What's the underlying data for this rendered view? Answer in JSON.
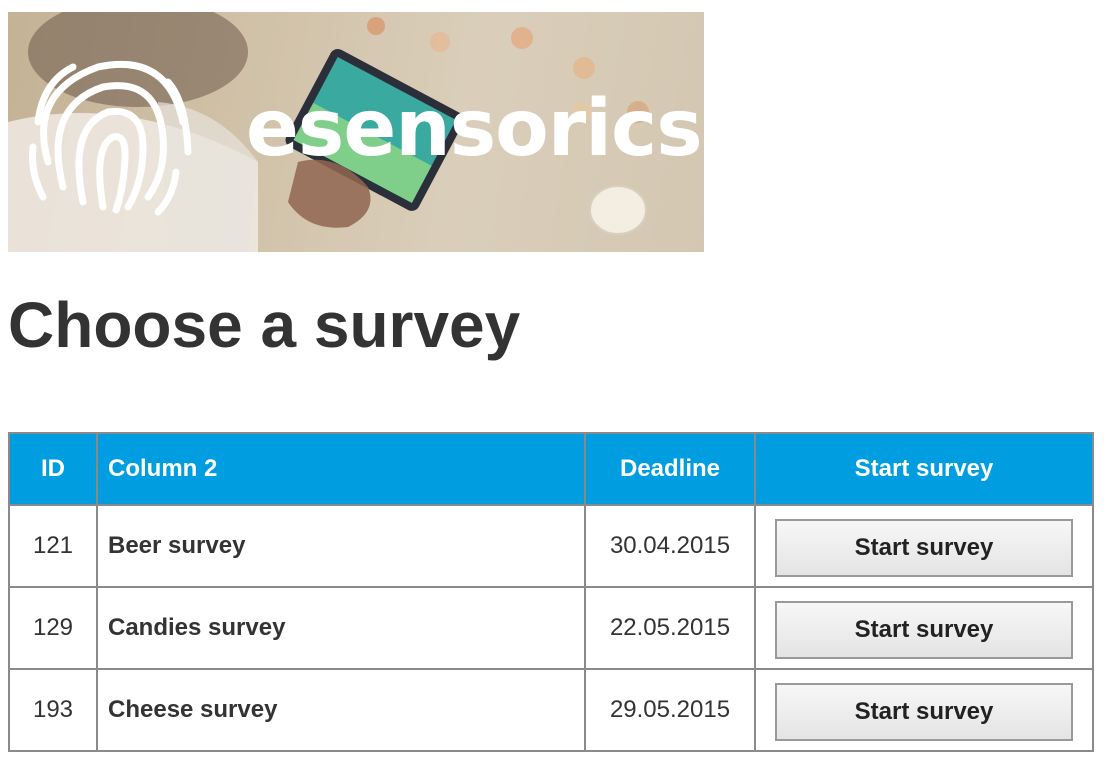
{
  "brand": {
    "name": "esensorics",
    "logo_icon": "fingerprint-icon"
  },
  "page": {
    "title": "Choose a survey"
  },
  "table": {
    "headers": {
      "id": "ID",
      "name": "Column 2",
      "deadline": "Deadline",
      "action": "Start survey"
    },
    "rows": [
      {
        "id": "121",
        "name": "Beer survey",
        "deadline": "30.04.2015",
        "button": "Start survey"
      },
      {
        "id": "129",
        "name": "Candies survey",
        "deadline": "22.05.2015",
        "button": "Start survey"
      },
      {
        "id": "193",
        "name": "Cheese survey",
        "deadline": "29.05.2015",
        "button": "Start survey"
      }
    ]
  },
  "colors": {
    "header_bg": "#009ee0",
    "header_text": "#ffffff",
    "title_text": "#333333"
  }
}
